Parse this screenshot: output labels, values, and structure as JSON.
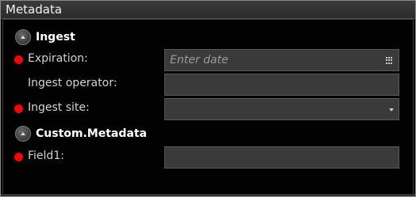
{
  "panel": {
    "title": "Metadata"
  },
  "sections": [
    {
      "title": "Ingest",
      "fields": [
        {
          "label": "Expiration:",
          "required": true,
          "type": "date",
          "placeholder": "Enter date",
          "value": ""
        },
        {
          "label": "Ingest operator:",
          "required": false,
          "type": "text",
          "placeholder": "",
          "value": ""
        },
        {
          "label": "Ingest site:",
          "required": true,
          "type": "select",
          "placeholder": "",
          "value": ""
        }
      ]
    },
    {
      "title": "Custom.Metadata",
      "fields": [
        {
          "label": "Field1:",
          "required": true,
          "type": "text",
          "placeholder": "",
          "value": ""
        }
      ]
    }
  ],
  "icons": {
    "collapse": "chevron-up-icon",
    "calendar": "calendar-icon",
    "dropdown": "chevron-down-icon",
    "required": "required-indicator-icon"
  },
  "colors": {
    "required": "#ff0000",
    "field_bg": "#3a3a3a",
    "header_bg": "#333333"
  }
}
